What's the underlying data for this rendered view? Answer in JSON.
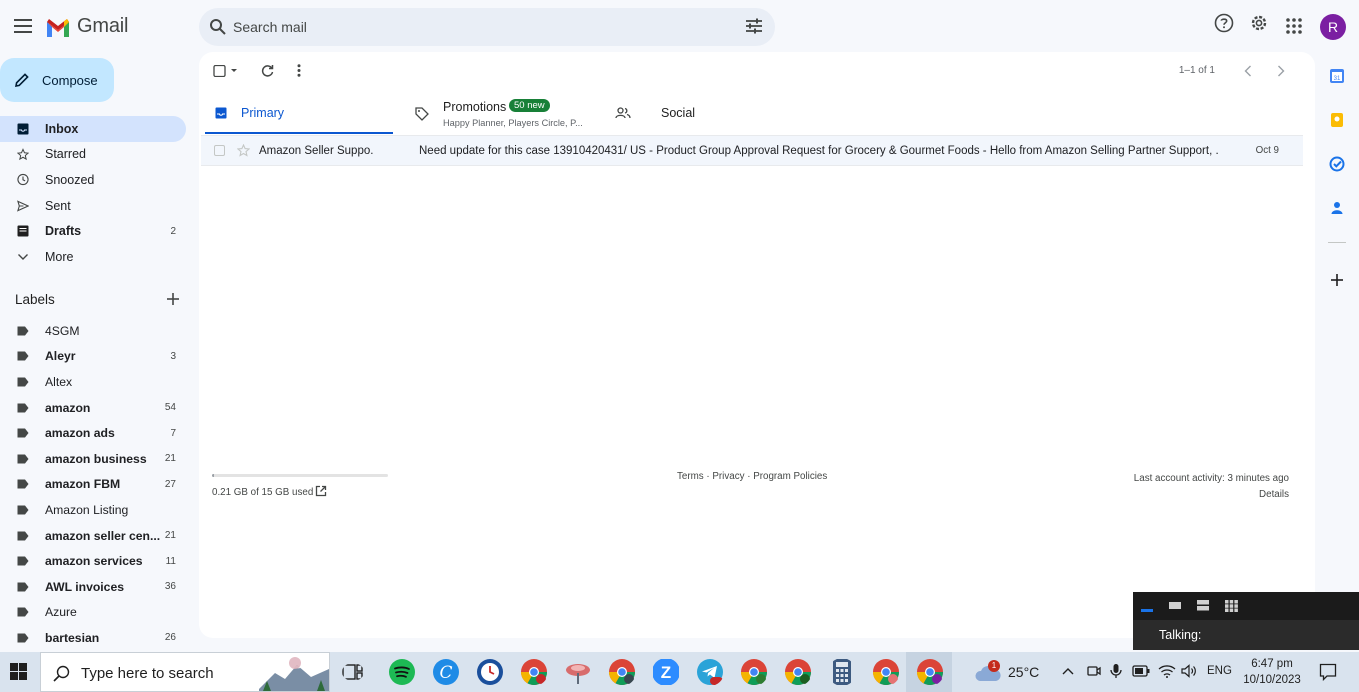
{
  "header": {
    "brand": "Gmail",
    "search_placeholder": "Search mail",
    "avatar_letter": "R"
  },
  "compose_label": "Compose",
  "nav": [
    {
      "label": "Inbox",
      "count": "",
      "icon": "inbox-icon",
      "active": true
    },
    {
      "label": "Starred",
      "count": "",
      "icon": "star-icon"
    },
    {
      "label": "Snoozed",
      "count": "",
      "icon": "clock-icon"
    },
    {
      "label": "Sent",
      "count": "",
      "icon": "send-icon"
    },
    {
      "label": "Drafts",
      "count": "2",
      "icon": "draft-icon",
      "bold": true
    },
    {
      "label": "More",
      "count": "",
      "icon": "chevron-down-icon"
    }
  ],
  "labels_heading": "Labels",
  "labels": [
    {
      "name": "4SGM",
      "count": "",
      "bold": false
    },
    {
      "name": "Aleyr",
      "count": "3",
      "bold": true
    },
    {
      "name": "Altex",
      "count": "",
      "bold": false
    },
    {
      "name": "amazon",
      "count": "54",
      "bold": true
    },
    {
      "name": "amazon ads",
      "count": "7",
      "bold": true
    },
    {
      "name": "amazon business",
      "count": "21",
      "bold": true
    },
    {
      "name": "amazon FBM",
      "count": "27",
      "bold": true
    },
    {
      "name": "Amazon Listing",
      "count": "",
      "bold": false
    },
    {
      "name": "amazon seller cen...",
      "count": "21",
      "bold": true
    },
    {
      "name": "amazon services",
      "count": "11",
      "bold": true
    },
    {
      "name": "AWL invoices",
      "count": "36",
      "bold": true
    },
    {
      "name": "Azure",
      "count": "",
      "bold": false
    },
    {
      "name": "bartesian",
      "count": "26",
      "bold": true
    }
  ],
  "toolbar": {
    "pager": "1–1 of 1"
  },
  "tabs": {
    "primary": "Primary",
    "promotions": "Promotions",
    "promotions_badge": "50 new",
    "promotions_sub": "Happy Planner, Players Circle, P...",
    "social": "Social"
  },
  "emails": [
    {
      "sender": "Amazon Seller Suppo.",
      "subject": "Need update for this case 13910420431/ US - Product Group Approval Request for Grocery & Gourmet Foods - Hello from Amazon Selling Partner Support, ...",
      "date": "Oct 9"
    }
  ],
  "footer": {
    "storage": "0.21 GB of 15 GB used",
    "storage_used_fraction": 0.014,
    "policies": "Terms · Privacy · Program Policies",
    "activity": "Last account activity: 3 minutes ago",
    "details": "Details"
  },
  "talk_widget": {
    "label": "Talking:"
  },
  "taskbar": {
    "search_placeholder": "Type here to search",
    "weather": "25°C",
    "weather_badge": "1",
    "language": "ENG",
    "time": "6:47 pm",
    "date": "10/10/2023"
  },
  "colors": {
    "accent": "#0b57d0",
    "compose_bg": "#c2e7ff",
    "active_nav": "#d3e3fd",
    "badge_green": "#188038",
    "avatar": "#7b1fa2"
  }
}
